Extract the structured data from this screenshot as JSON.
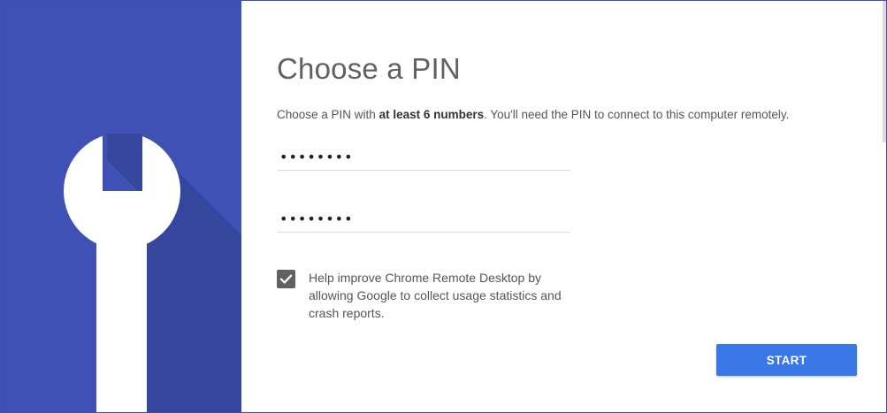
{
  "dialog": {
    "title": "Choose a PIN",
    "description_prefix": "Choose a PIN with ",
    "description_bold": "at least 6 numbers",
    "description_suffix": ". You'll need the PIN to connect to this computer remotely.",
    "pin_value": "••••••••",
    "pin_confirm_value": "••••••••",
    "checkbox_checked": true,
    "checkbox_label": "Help improve Chrome Remote Desktop by allowing Google to collect usage statistics and crash reports.",
    "start_label": "START"
  },
  "icon": {
    "name": "wrench-icon"
  },
  "colors": {
    "panel_background": "#3f51b5",
    "panel_shadow": "#36469c",
    "button_background": "#3b78e7",
    "checkbox_fill": "#616161"
  }
}
